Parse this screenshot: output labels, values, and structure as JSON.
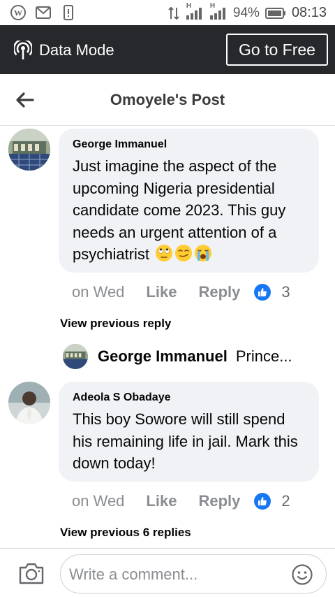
{
  "status_bar": {
    "battery": "94%",
    "time": "08:13",
    "signal_label_1": "H",
    "signal_label_2": "H"
  },
  "data_bar": {
    "mode_label": "Data Mode",
    "go_free_label": "Go to Free"
  },
  "header": {
    "title": "Omoyele's Post"
  },
  "comments": [
    {
      "author": "George Immanuel",
      "text": "Just imagine the aspect of the upcoming Nigeria presidential candidate come 2023. This guy needs an urgent attention of a psychiatrist",
      "emojis": [
        "face-with-rolling-eyes",
        "smirking-face",
        "loudly-crying-face"
      ],
      "time": "on Wed",
      "like_label": "Like",
      "reply_label": "Reply",
      "like_count": "3",
      "view_previous": "View previous reply"
    },
    {
      "author": "Adeola S Obadaye",
      "text": "This boy Sowore will still spend his remaining life in jail. Mark this down today!",
      "time": "on Wed",
      "like_label": "Like",
      "reply_label": "Reply",
      "like_count": "2",
      "view_previous": "View previous 6 replies"
    }
  ],
  "reply_preview": {
    "author": "George Immanuel",
    "text": "Prince..."
  },
  "composer": {
    "placeholder": "Write a comment..."
  },
  "colors": {
    "accent": "#1877f2",
    "data_bar_bg": "#27282c",
    "bubble_bg": "#f0f2f5",
    "muted_text": "#8a8d91"
  }
}
